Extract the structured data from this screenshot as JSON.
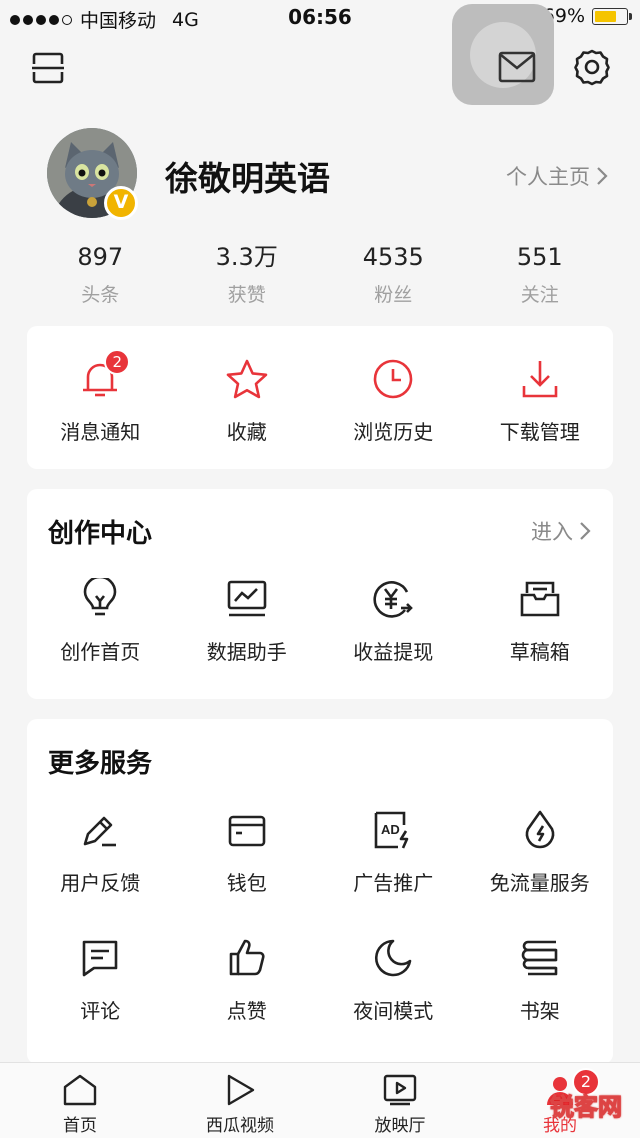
{
  "status_bar": {
    "carrier": "中国移动",
    "network": "4G",
    "time": "06:56",
    "battery": "69%",
    "battery_level": 0.69,
    "battery_color": "#f5c400"
  },
  "header": {
    "left_icon": "scan-frame-icon",
    "mail_icon": "mail-icon",
    "settings_icon": "gear-icon"
  },
  "profile": {
    "name": "徐敬明英语",
    "verified_badge": "V",
    "homepage_link": "个人主页",
    "stats": [
      {
        "value": "897",
        "label": "头条"
      },
      {
        "value": "3.3万",
        "label": "获赞"
      },
      {
        "value": "4535",
        "label": "粉丝"
      },
      {
        "value": "551",
        "label": "关注"
      }
    ]
  },
  "quick_actions": [
    {
      "label": "消息通知",
      "icon": "bell-icon",
      "badge": "2"
    },
    {
      "label": "收藏",
      "icon": "star-icon"
    },
    {
      "label": "浏览历史",
      "icon": "clock-icon"
    },
    {
      "label": "下载管理",
      "icon": "download-icon"
    }
  ],
  "creation_center": {
    "title": "创作中心",
    "link": "进入",
    "items": [
      {
        "label": "创作首页",
        "icon": "lightbulb-icon"
      },
      {
        "label": "数据助手",
        "icon": "chart-monitor-icon"
      },
      {
        "label": "收益提现",
        "icon": "yuan-withdraw-icon"
      },
      {
        "label": "草稿箱",
        "icon": "draft-box-icon"
      }
    ]
  },
  "more_services": {
    "title": "更多服务",
    "items": [
      {
        "label": "用户反馈",
        "icon": "pencil-icon"
      },
      {
        "label": "钱包",
        "icon": "wallet-icon"
      },
      {
        "label": "广告推广",
        "icon": "ad-icon",
        "icon_text": "AD"
      },
      {
        "label": "免流量服务",
        "icon": "drop-icon"
      },
      {
        "label": "评论",
        "icon": "comment-icon"
      },
      {
        "label": "点赞",
        "icon": "thumbs-up-icon"
      },
      {
        "label": "夜间模式",
        "icon": "moon-icon"
      },
      {
        "label": "书架",
        "icon": "bookshelf-icon"
      }
    ]
  },
  "tab_bar": {
    "items": [
      {
        "label": "首页",
        "icon": "home-icon"
      },
      {
        "label": "西瓜视频",
        "icon": "play-icon"
      },
      {
        "label": "放映厅",
        "icon": "tv-play-icon"
      },
      {
        "label": "我的",
        "icon": "profile-icon",
        "badge": "2"
      }
    ],
    "watermark": "锐客网"
  },
  "colors": {
    "accent": "#e8343a",
    "background": "#f5f5f5",
    "card": "#ffffff",
    "muted_text": "#a0a0a0"
  }
}
